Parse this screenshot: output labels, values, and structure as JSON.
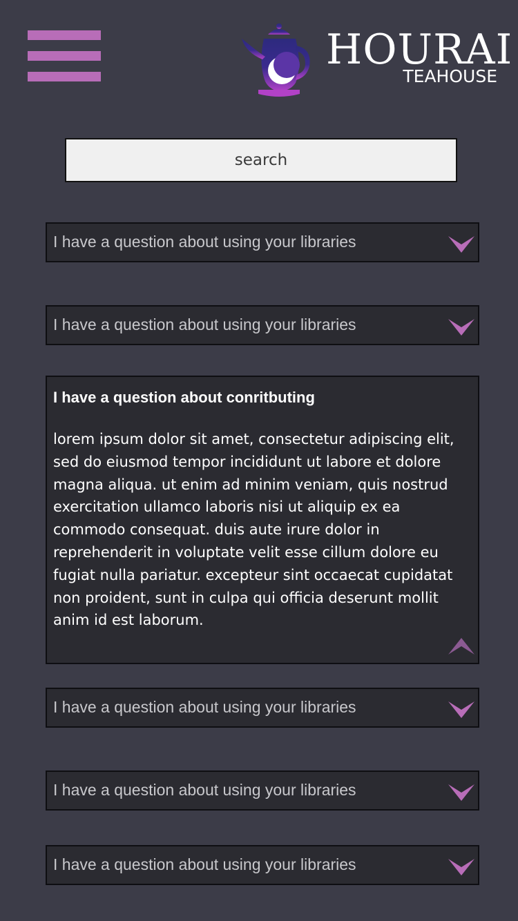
{
  "header": {
    "menu_icon": "hamburger-menu-icon",
    "logo": {
      "icon": "teapot-moon-icon",
      "wordmark": "HOURAI",
      "subtitle": "TEAHOUSE"
    }
  },
  "search": {
    "placeholder": "search"
  },
  "faq": {
    "items": [
      {
        "question": "I have a question about using your libraries",
        "expanded": false
      },
      {
        "question": "I have a question about using your libraries",
        "expanded": false
      },
      {
        "question": "I have a question about conritbuting",
        "answer": "lorem ipsum dolor sit amet, consectetur adipiscing elit, sed do eiusmod tempor incididunt ut labore et dolore magna aliqua. ut enim ad minim veniam, quis nostrud exercitation ullamco laboris nisi ut aliquip ex ea commodo consequat. duis aute irure dolor in reprehenderit in voluptate velit esse cillum dolore eu fugiat nulla pariatur. excepteur sint occaecat cupidatat non proident, sunt in culpa qui officia deserunt mollit anim id est laborum.",
        "expanded": true
      },
      {
        "question": "I have a question about using your libraries",
        "expanded": false
      },
      {
        "question": "I have a question about using your libraries",
        "expanded": false
      },
      {
        "question": "I have a question about using your libraries",
        "expanded": false
      }
    ],
    "expand_icon": "chevron-down-icon",
    "collapse_icon": "chevron-up-icon"
  },
  "colors": {
    "background": "#3c3c48",
    "accent": "#b86db8",
    "card": "#2b2b31",
    "search_bg": "#f0f0f0"
  }
}
